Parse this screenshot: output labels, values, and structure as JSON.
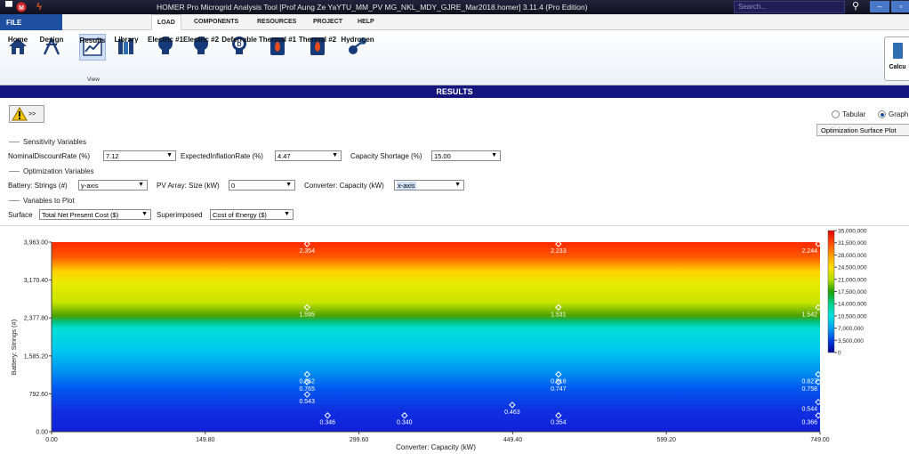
{
  "window": {
    "title": "HOMER Pro Microgrid Analysis Tool [Prof Aung Ze YaYTU_MM_PV MG_NKL_MDY_GJRE_Mar2018.homer]  3.11.4 (Pro Edition)",
    "search_placeholder": "Search..."
  },
  "ribbon_tabs": [
    "FILE",
    "LOAD",
    "COMPONENTS",
    "RESOURCES",
    "PROJECT",
    "HELP"
  ],
  "ribbon_view": {
    "buttons": [
      "Home",
      "Design",
      "Results",
      "Library"
    ],
    "group_label": "View"
  },
  "ribbon_load": {
    "buttons": [
      "Electric #1",
      "Electric #2",
      "Deferrable",
      "Thermal #1",
      "Thermal #2",
      "Hydrogen"
    ]
  },
  "calc_button": "Calcu",
  "results_title": "RESULTS",
  "warn_label": ">>",
  "display_mode": {
    "options": [
      "Tabular",
      "Graph"
    ],
    "selected": "Graph"
  },
  "plot_type_button": "Optimization Surface Plot",
  "sensitivity": {
    "title": "Sensitivity Variables",
    "discount_label": "NominalDiscountRate (%)",
    "discount_value": "7.12",
    "inflation_label": "ExpectedInflationRate (%)",
    "inflation_value": "4.47",
    "shortage_label": "Capacity Shortage (%)",
    "shortage_value": "15.00"
  },
  "optimization": {
    "title": "Optimization Variables",
    "battery_label": "Battery: Strings (#)",
    "battery_value": "y-axis",
    "pv_label": "PV Array: Size (kW)",
    "pv_value": "0",
    "converter_label": "Converter: Capacity (kW)",
    "converter_value": "x-axis"
  },
  "plot_vars": {
    "title": "Variables to Plot",
    "surface_label": "Surface",
    "surface_value": "Total Net Present Cost ($)",
    "superimposed_label": "Superimposed",
    "superimposed_value": "Cost of Energy ($)"
  },
  "chart_data": {
    "type": "heatmap",
    "xlabel": "Converter: Capacity (kW)",
    "ylabel": "Battery: Strings (#)",
    "xlim": [
      0,
      749
    ],
    "ylim": [
      0,
      3963
    ],
    "x_ticks": [
      "0.00",
      "149.80",
      "299.60",
      "449.40",
      "599.20",
      "749.00"
    ],
    "y_ticks": [
      "0.00",
      "792.60",
      "1,585.20",
      "2,377.80",
      "3,170.40",
      "3,963.00"
    ],
    "colorbar_ticks": [
      "35,000,000",
      "31,500,000",
      "28,000,000",
      "24,500,000",
      "21,000,000",
      "17,500,000",
      "14,000,000",
      "10,500,000",
      "7,000,000",
      "3,500,000",
      "0"
    ],
    "colorbar_colors": [
      "#e00000",
      "#ff4a00",
      "#ff9a00",
      "#ffe000",
      "#b6e000",
      "#1fa000",
      "#00d08a",
      "#00e0e0",
      "#00a0f0",
      "#0040e0",
      "#000090"
    ],
    "surface_bands": [
      {
        "y": 3963,
        "color": "#ff2800"
      },
      {
        "y": 3650,
        "color": "#ff5a00"
      },
      {
        "y": 3350,
        "color": "#ffd400"
      },
      {
        "y": 3100,
        "color": "#e8ea00"
      },
      {
        "y": 2700,
        "color": "#c8e400"
      },
      {
        "y": 2420,
        "color": "#4aa000"
      },
      {
        "y": 2300,
        "color": "#00bf80"
      },
      {
        "y": 2150,
        "color": "#00e0d8"
      },
      {
        "y": 1700,
        "color": "#00c8f0"
      },
      {
        "y": 1250,
        "color": "#0090f0"
      },
      {
        "y": 900,
        "color": "#0058f0"
      },
      {
        "y": 450,
        "color": "#1030e0"
      },
      {
        "y": 0,
        "color": "#1020d8"
      }
    ],
    "coe_points": [
      {
        "x": 249,
        "y": 3963,
        "label": "2.354"
      },
      {
        "x": 494,
        "y": 3963,
        "label": "2.233"
      },
      {
        "x": 749,
        "y": 3963,
        "label": "2.244"
      },
      {
        "x": 249,
        "y": 2600,
        "label": "1.595"
      },
      {
        "x": 494,
        "y": 2600,
        "label": "1.531"
      },
      {
        "x": 749,
        "y": 2600,
        "label": "1.542"
      },
      {
        "x": 249,
        "y": 1200,
        "label": "0.852"
      },
      {
        "x": 249,
        "y": 1040,
        "label": "0.765"
      },
      {
        "x": 494,
        "y": 1200,
        "label": "0.816"
      },
      {
        "x": 494,
        "y": 1040,
        "label": "0.747"
      },
      {
        "x": 749,
        "y": 1200,
        "label": "0.827"
      },
      {
        "x": 749,
        "y": 1040,
        "label": "0.758"
      },
      {
        "x": 249,
        "y": 780,
        "label": "0.543"
      },
      {
        "x": 749,
        "y": 620,
        "label": "0.544"
      },
      {
        "x": 449,
        "y": 560,
        "label": "0.463"
      },
      {
        "x": 269,
        "y": 340,
        "label": "0.346"
      },
      {
        "x": 344,
        "y": 340,
        "label": "0.340"
      },
      {
        "x": 494,
        "y": 340,
        "label": "0.354"
      },
      {
        "x": 749,
        "y": 340,
        "label": "0.366"
      }
    ]
  }
}
